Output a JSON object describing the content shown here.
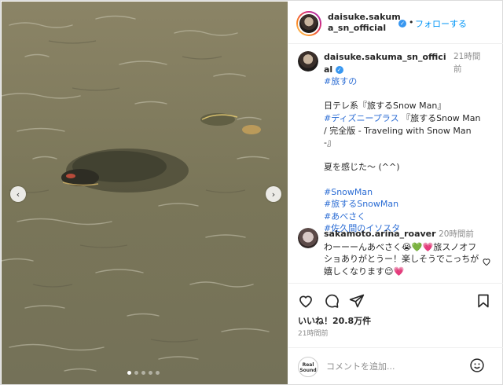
{
  "post": {
    "username": "daisuke.sakuma_sn_official",
    "follow_label": "フォローする",
    "separator": "•"
  },
  "caption": {
    "username": "daisuke.sakuma_sn_official",
    "time": "21時間前",
    "lines": [
      {
        "text": "#旅すの",
        "tag": true
      },
      {
        "text": "",
        "tag": false
      },
      {
        "text": "日テレ系『旅するSnow Man』",
        "tag": false
      },
      {
        "text": "#ディズニープラス",
        "tag": true,
        "rest": "『旅するSnow Man / 完全版 - Traveling with Snow Man -』"
      },
      {
        "text": "",
        "tag": false
      },
      {
        "text": "夏を感じた〜 (^^)",
        "tag": false
      },
      {
        "text": "",
        "tag": false
      },
      {
        "text": "#SnowMan",
        "tag": true
      },
      {
        "text": "#旅するSnowMan",
        "tag": true
      },
      {
        "text": "#あべさく",
        "tag": true
      },
      {
        "text": "#佐久間のイソスタ",
        "tag": true
      }
    ]
  },
  "comment": {
    "username": "sakamoto.arina_roaver",
    "time": "20時間前",
    "text": "わーーーんあべさく😭💚💗旅スノオフショありがとうー！楽しそうでこっちが嬉しくなります😌💗"
  },
  "stats": {
    "likes": "いいね！20.8万件",
    "ago": "21時間前"
  },
  "add_comment": {
    "placeholder": "コメントを追加...",
    "logo_line1": "Real",
    "logo_line2": "Sound"
  },
  "icons": {
    "prev": "chevron-left-icon",
    "next": "chevron-right-icon",
    "like": "heart-icon",
    "comment": "comment-icon",
    "share": "paper-plane-icon",
    "save": "bookmark-icon",
    "emoji": "smiley-icon",
    "verified": "verified-badge-icon"
  },
  "carousel": {
    "count": 5,
    "active": 0
  },
  "colors": {
    "accent": "#0095f6",
    "hashtag": "#2c6dd4",
    "muted": "#8e8e8e"
  }
}
